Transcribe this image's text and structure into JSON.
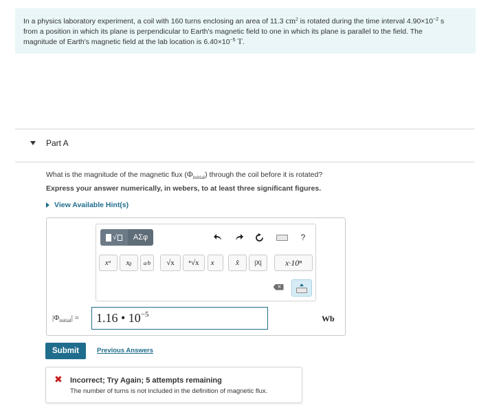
{
  "problem": {
    "p1": "In a physics laboratory experiment, a coil with 160 turns enclosing an area of 11.3",
    "area_unit": "cm",
    "area_exp": "2",
    "p2": " is rotated during the time interval 4.90×10",
    "time_exp": "−2",
    "time_unit": " s",
    "p3": "from a position in which its plane is perpendicular to Earth's magnetic field to one in which its plane is parallel to the field. The",
    "p4": "magnitude of Earth's magnetic field at the lab location is 6.40×10",
    "field_exp": "−5",
    "field_unit": "T",
    "p5": "."
  },
  "part": {
    "title": "Part A",
    "question_pre": "What is the magnitude of the magnetic flux (",
    "question_phi": "Φ",
    "question_sub": "initial",
    "question_post": ") through the coil before it is rotated?",
    "instruction": "Express your answer numerically, in webers, to at least three significant figures.",
    "hints": "View Available Hint(s)"
  },
  "toolbar": {
    "greek_label": "ΑΣφ",
    "sqrt_symbol": "√",
    "undo_icon": "undo-arrow",
    "redo_icon": "redo-arrow",
    "reset_icon": "reset-circle-arrow",
    "help_label": "?",
    "superscript_label": "xᵃ",
    "subscript_label": "xᵦ",
    "fraction_label": "a/b",
    "sqrt_label": "√x",
    "nthroot_label": "ⁿ√x",
    "vector_label": "x⃗",
    "unitvector_label": "x̂",
    "abs_label": "|X|",
    "sci_label": "x·10ⁿ"
  },
  "answer": {
    "lhs_phi": "Φ",
    "lhs_sub": "initial",
    "lhs_eq": "=",
    "mantissa": "1.16 • 10",
    "exponent": "−5",
    "unit": "Wb"
  },
  "actions": {
    "submit": "Submit",
    "previous": "Previous Answers"
  },
  "feedback": {
    "icon": "✖",
    "title": "Incorrect; Try Again; 5 attempts remaining",
    "message": "The number of turns is not included in the definition of magnetic flux."
  },
  "colors": {
    "accent": "#1f6d8c",
    "problem_bg": "#eaf6f8",
    "error": "#c81e1e"
  }
}
